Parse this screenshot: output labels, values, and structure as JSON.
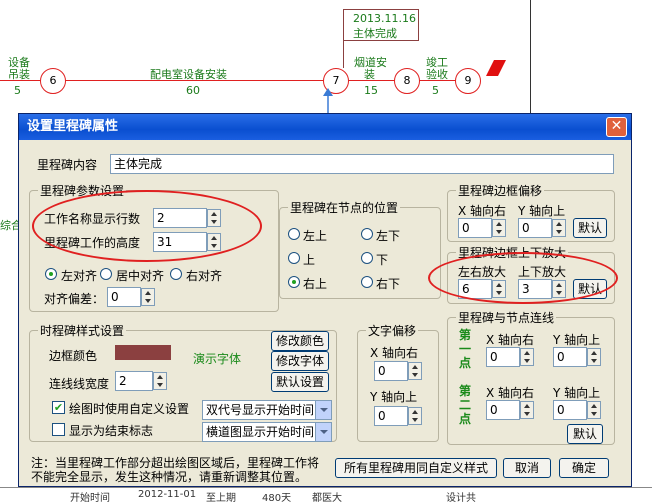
{
  "diagram": {
    "nodes": [
      "6",
      "7",
      "8",
      "9"
    ],
    "milestone_date": "2013.11.16",
    "milestone_name": "主体完成",
    "tasks": [
      {
        "name_line1": "设备",
        "name_line2": "吊装",
        "duration": "5"
      },
      {
        "name": "配电室设备安装",
        "duration": "60"
      },
      {
        "name_line1": "烟道安",
        "name_line2": "装",
        "duration": "15"
      },
      {
        "name_line1": "竣工",
        "name_line2": "验收",
        "duration": "5"
      }
    ],
    "left_fragment": "综合",
    "bottom_fragments": [
      "开始时间",
      "2012-11-01",
      "至上期",
      "480天",
      "都医大",
      "设计共"
    ]
  },
  "dialog": {
    "title": "设置里程碑属性",
    "close_label": "✕",
    "content_label": "里程碑内容",
    "content_value": "主体完成",
    "params": {
      "title": "里程碑参数设置",
      "rows_label": "工作名称显示行数",
      "rows_value": "2",
      "height_label": "里程碑工作的高度",
      "height_value": "31",
      "align_left": "左对齐",
      "align_center": "居中对齐",
      "align_right": "右对齐",
      "offset_label": "对齐偏差：",
      "offset_value": "0"
    },
    "position": {
      "title": "里程碑在节点的位置",
      "options": [
        "左上",
        "左下",
        "上",
        "下",
        "右上",
        "右下"
      ],
      "selected": "右上"
    },
    "frame_offset": {
      "title": "里程碑边框偏移",
      "x_label": "X 轴向右",
      "y_label": "Y 轴向上",
      "x_value": "0",
      "y_value": "0",
      "default_label": "默认"
    },
    "frame_zoom": {
      "title": "里程碑边框上下放大",
      "lr_label": "左右放大",
      "ud_label": "上下放大",
      "lr_value": "6",
      "ud_value": "3",
      "default_label": "默认"
    },
    "style": {
      "title": "时程碑样式设置",
      "border_color_label": "边框颜色",
      "border_color": "#8b4040",
      "demo_font_label": "演示字体",
      "line_width_label": "连线线宽度",
      "line_width_value": "2",
      "custom_setting_label": "绘图时使用自定义设置",
      "custom_setting_checked": true,
      "show_end_label": "显示为结束标志",
      "show_end_checked": false,
      "modify_color_label": "修改颜色",
      "modify_font_label": "修改字体",
      "default_setting_label": "默认设置",
      "select1_value": "双代号显示开始时间",
      "select2_value": "横道图显示开始时间"
    },
    "text_offset": {
      "title": "文字偏移",
      "x_label": "X 轴向右",
      "y_label": "Y 轴向上",
      "x_value": "0",
      "y_value": "0"
    },
    "node_link": {
      "title": "里程碑与节点连线",
      "point1_label": "第一点",
      "point2_label": "第二点",
      "x_label": "X 轴向右",
      "y_label": "Y 轴向上",
      "p1_x": "0",
      "p1_y": "0",
      "p2_x": "0",
      "p2_y": "0",
      "default_label": "默认"
    },
    "note": "注：当里程碑工作部分超出绘图区域后，里程碑工作将不能完全显示，发生这种情况，请重新调整其位置。",
    "all_custom_label": "所有里程碑用同自定义样式",
    "cancel_label": "取消",
    "ok_label": "确定"
  },
  "colors": {
    "node_border": "#e02020",
    "task_text": "#1a7a1a",
    "milestone_border": "#8b4040",
    "flag": "#e01010",
    "annotation": "#e02020"
  }
}
